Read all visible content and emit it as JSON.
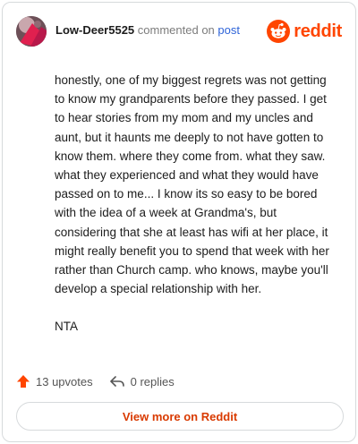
{
  "header": {
    "username": "Low-Deer5525",
    "commented_on_text": "commented on",
    "post_link": "post",
    "logo_text": "reddit",
    "avatar": "user-avatar",
    "brand_color": "#ff4500"
  },
  "comment": {
    "paragraphs": [
      "honestly, one of my biggest regrets was not getting to know my grandparents before they passed. I get to hear stories from my mom and my uncles and aunt, but it haunts me deeply to not have gotten to know them. where they come from. what they saw. what they experienced and what they would have passed on to me... I know its so easy to be bored with the idea of a week at Grandma's, but considering that she at least has wifi at her place, it might really benefit you to spend that week with her rather than Church camp. who knows, maybe you'll develop a special relationship with her.",
      "NTA"
    ]
  },
  "footer": {
    "upvotes": "13 upvotes",
    "replies": "0 replies",
    "view_more": "View more on Reddit",
    "upvote_icon": "upvote-arrow-icon",
    "reply_icon": "reply-arrow-icon",
    "upvote_color": "#ff4500",
    "link_color": "#d93a00"
  }
}
